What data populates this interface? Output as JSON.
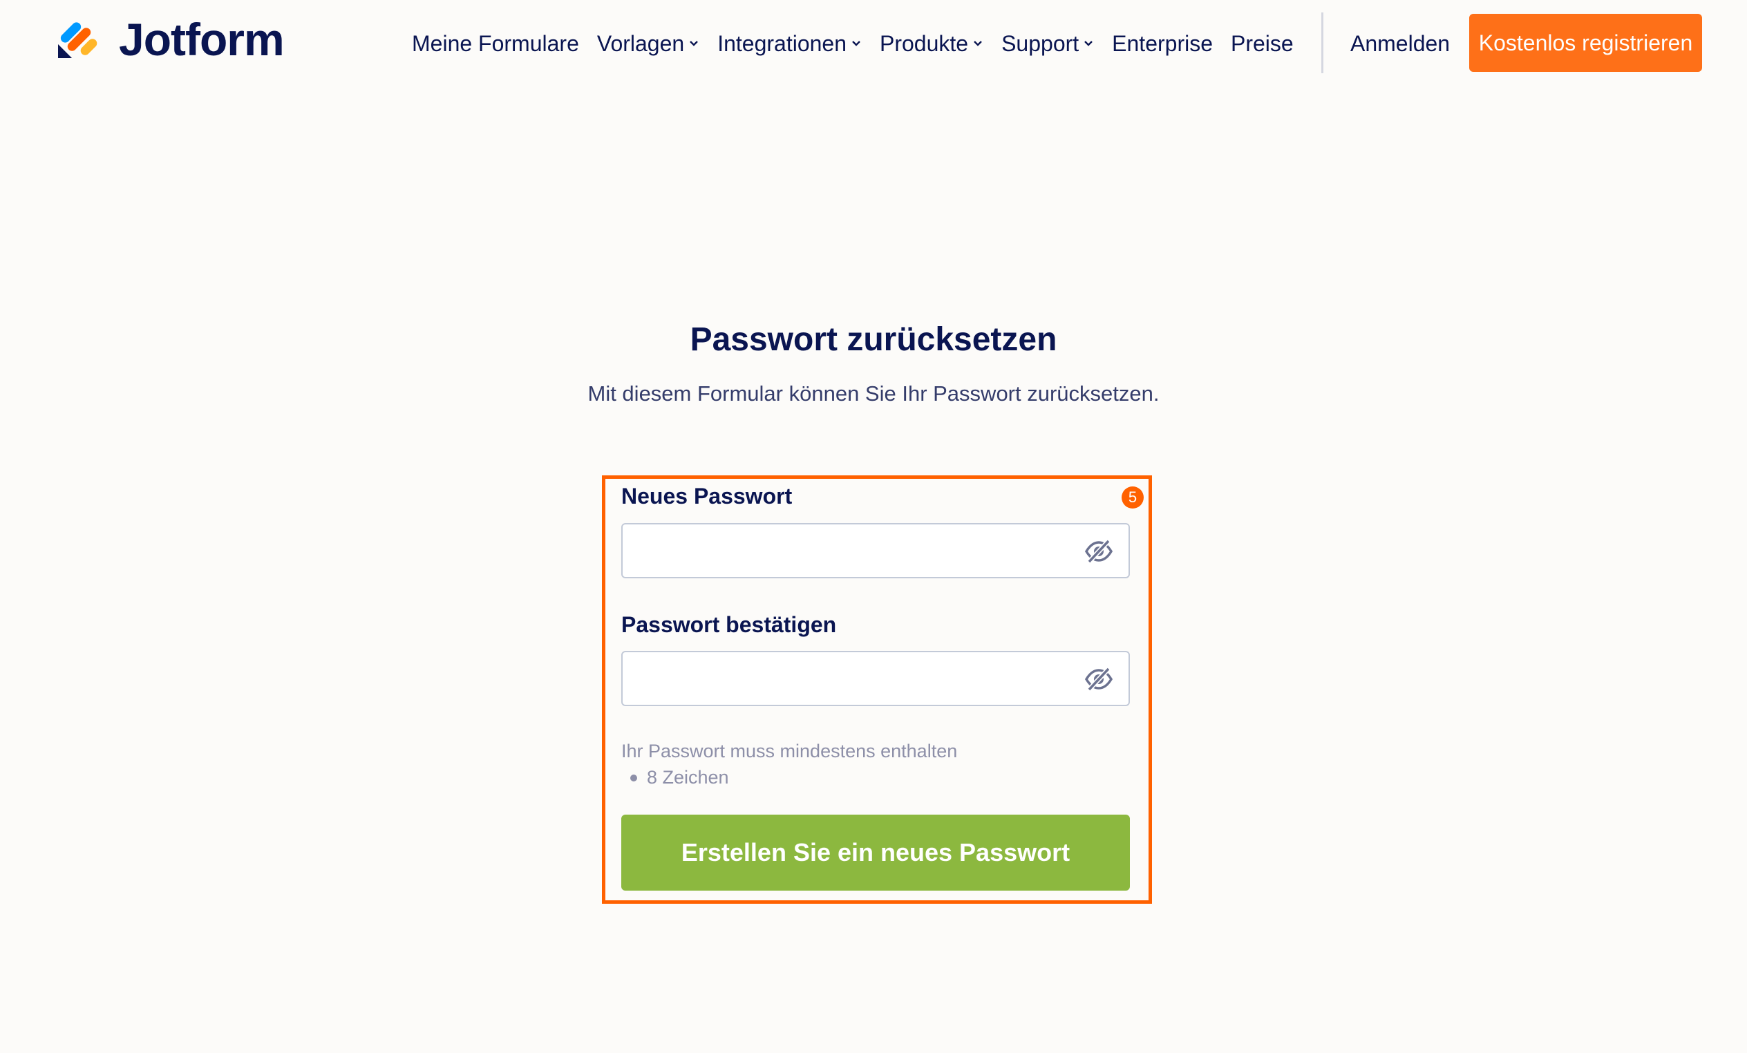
{
  "brand": {
    "name": "Jotform",
    "colors": {
      "orange": "#ff6100",
      "navy": "#0a1551",
      "green": "#8cb83f",
      "blue": "#0099ff",
      "yellow": "#ffb629"
    }
  },
  "nav": {
    "items": [
      {
        "label": "Meine Formulare",
        "dropdown": false
      },
      {
        "label": "Vorlagen",
        "dropdown": true
      },
      {
        "label": "Integrationen",
        "dropdown": true
      },
      {
        "label": "Produkte",
        "dropdown": true
      },
      {
        "label": "Support",
        "dropdown": true
      },
      {
        "label": "Enterprise",
        "dropdown": false
      },
      {
        "label": "Preise",
        "dropdown": false
      }
    ],
    "login_label": "Anmelden",
    "signup_label": "Kostenlos registrieren"
  },
  "main": {
    "title": "Passwort zurücksetzen",
    "subtitle": "Mit diesem Formular können Sie Ihr Passwort zurücksetzen.",
    "highlight_badge": "5",
    "new_password": {
      "label": "Neues Passwort",
      "value": "",
      "icon": "eye-slash-icon"
    },
    "confirm_password": {
      "label": "Passwort bestätigen",
      "value": "",
      "icon": "eye-slash-icon"
    },
    "requirements_heading": "Ihr Passwort muss mindestens enthalten",
    "requirements": [
      "8 Zeichen"
    ],
    "submit_label": "Erstellen Sie ein neues Passwort"
  }
}
